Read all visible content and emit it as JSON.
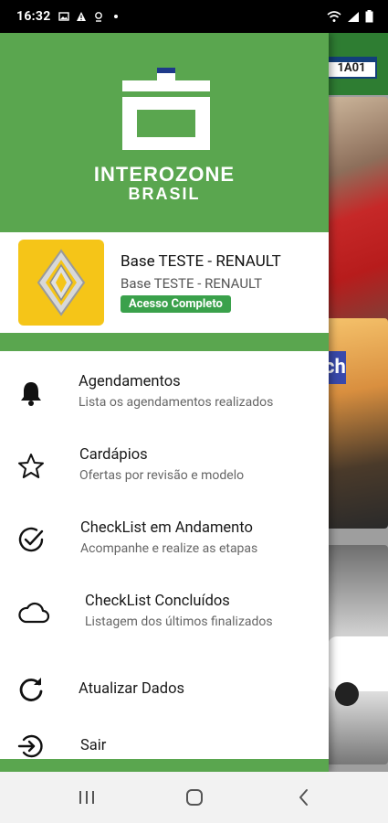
{
  "status_bar": {
    "time": "16:32",
    "left_icons": [
      "image-icon",
      "alert-icon",
      "location-icon",
      "dot-icon"
    ],
    "right_icons": [
      "wifi-icon",
      "signal-icon",
      "battery-icon"
    ]
  },
  "background": {
    "plate_text": "1A01",
    "card_chip_text": "ch"
  },
  "brand": {
    "line1": "INTEROZONE",
    "line2": "BRASIL",
    "header_color": "#5aa64f"
  },
  "account": {
    "title": "Base TESTE - RENAULT",
    "subtitle": "Base TESTE - RENAULT",
    "badge": "Acesso Completo",
    "badge_color": "#3aa14b",
    "logo_icon": "renault-logo"
  },
  "menu": {
    "items": [
      {
        "icon": "bell-icon",
        "title": "Agendamentos",
        "subtitle": "Lista os agendamentos realizados"
      },
      {
        "icon": "star-icon",
        "title": "Cardápios",
        "subtitle": "Ofertas por revisão e modelo"
      },
      {
        "icon": "check-circle-icon",
        "title": "CheckList em Andamento",
        "subtitle": "Acompanhe e realize as etapas"
      },
      {
        "icon": "cloud-icon",
        "title": "CheckList Concluídos",
        "subtitle": "Listagem dos últimos finalizados"
      },
      {
        "icon": "refresh-icon",
        "title": "Atualizar Dados",
        "subtitle": ""
      },
      {
        "icon": "logout-icon",
        "title": "Sair",
        "subtitle": ""
      }
    ]
  },
  "nav_bar": {
    "buttons": [
      "recents-button",
      "home-button",
      "back-button"
    ]
  }
}
